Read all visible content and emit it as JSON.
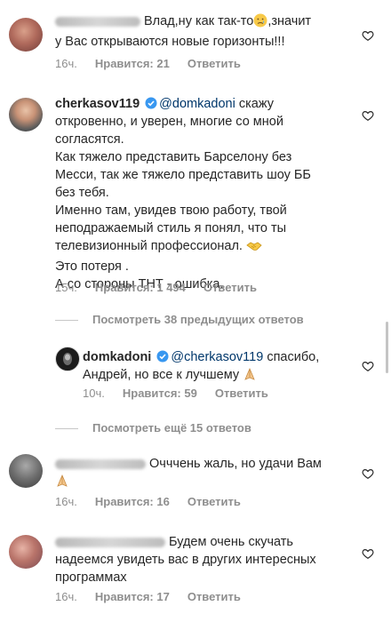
{
  "comments": [
    {
      "text": "Влад,ну как так-то",
      "text_after_emoji": ",значит",
      "text_line2": "у Вас открываются новые горизонты!!!",
      "time": "16ч.",
      "likes": "Нравится: 21",
      "reply": "Ответить"
    },
    {
      "username": "cherkasov119",
      "mention": "@domkadoni",
      "lines": [
        "скажу",
        "откровенно, и уверен, многие со мной",
        "согласятся.",
        "Как тяжело представить Барселону без",
        "Месси, так же тяжело представить шоу ББ",
        "без тебя.",
        "Именно там, увидев твою работу, твой",
        "неподражаемый стиль я понял, что ты",
        "телевизионный профессионал.",
        "Это потеря .",
        "А со стороны ТНТ - ошибка."
      ],
      "time": "15ч.",
      "likes": "Нравится: 1 494",
      "reply": "Ответить"
    },
    {
      "view_more": "Посмотреть 38 предыдущих ответов"
    },
    {
      "username": "domkadoni",
      "mention": "@cherkasov119",
      "line1_after": "спасибо,",
      "line2": "Андрей, но все к лучшему",
      "time": "10ч.",
      "likes": "Нравится: 59",
      "reply": "Ответить"
    },
    {
      "view_more": "Посмотреть ещё 15 ответов"
    },
    {
      "text_line1": "Очччень жаль, но удачи Вам",
      "time": "16ч.",
      "likes": "Нравится: 16",
      "reply": "Ответить"
    },
    {
      "text_line1": "Будем очень скучать",
      "text_line2": "надеемся увидеть вас в других интересных",
      "text_line3": "программах",
      "time": "16ч.",
      "likes": "Нравится: 17",
      "reply": "Ответить"
    }
  ],
  "icons": {
    "heart": "heart-outline-icon",
    "verified": "verified-badge-icon",
    "crying": "crying-face-emoji",
    "handshake": "handshake-emoji",
    "pray": "folded-hands-emoji"
  },
  "colors": {
    "text": "#262626",
    "meta": "#8e8e8e",
    "mention": "#00376b",
    "verified": "#3897f0"
  }
}
